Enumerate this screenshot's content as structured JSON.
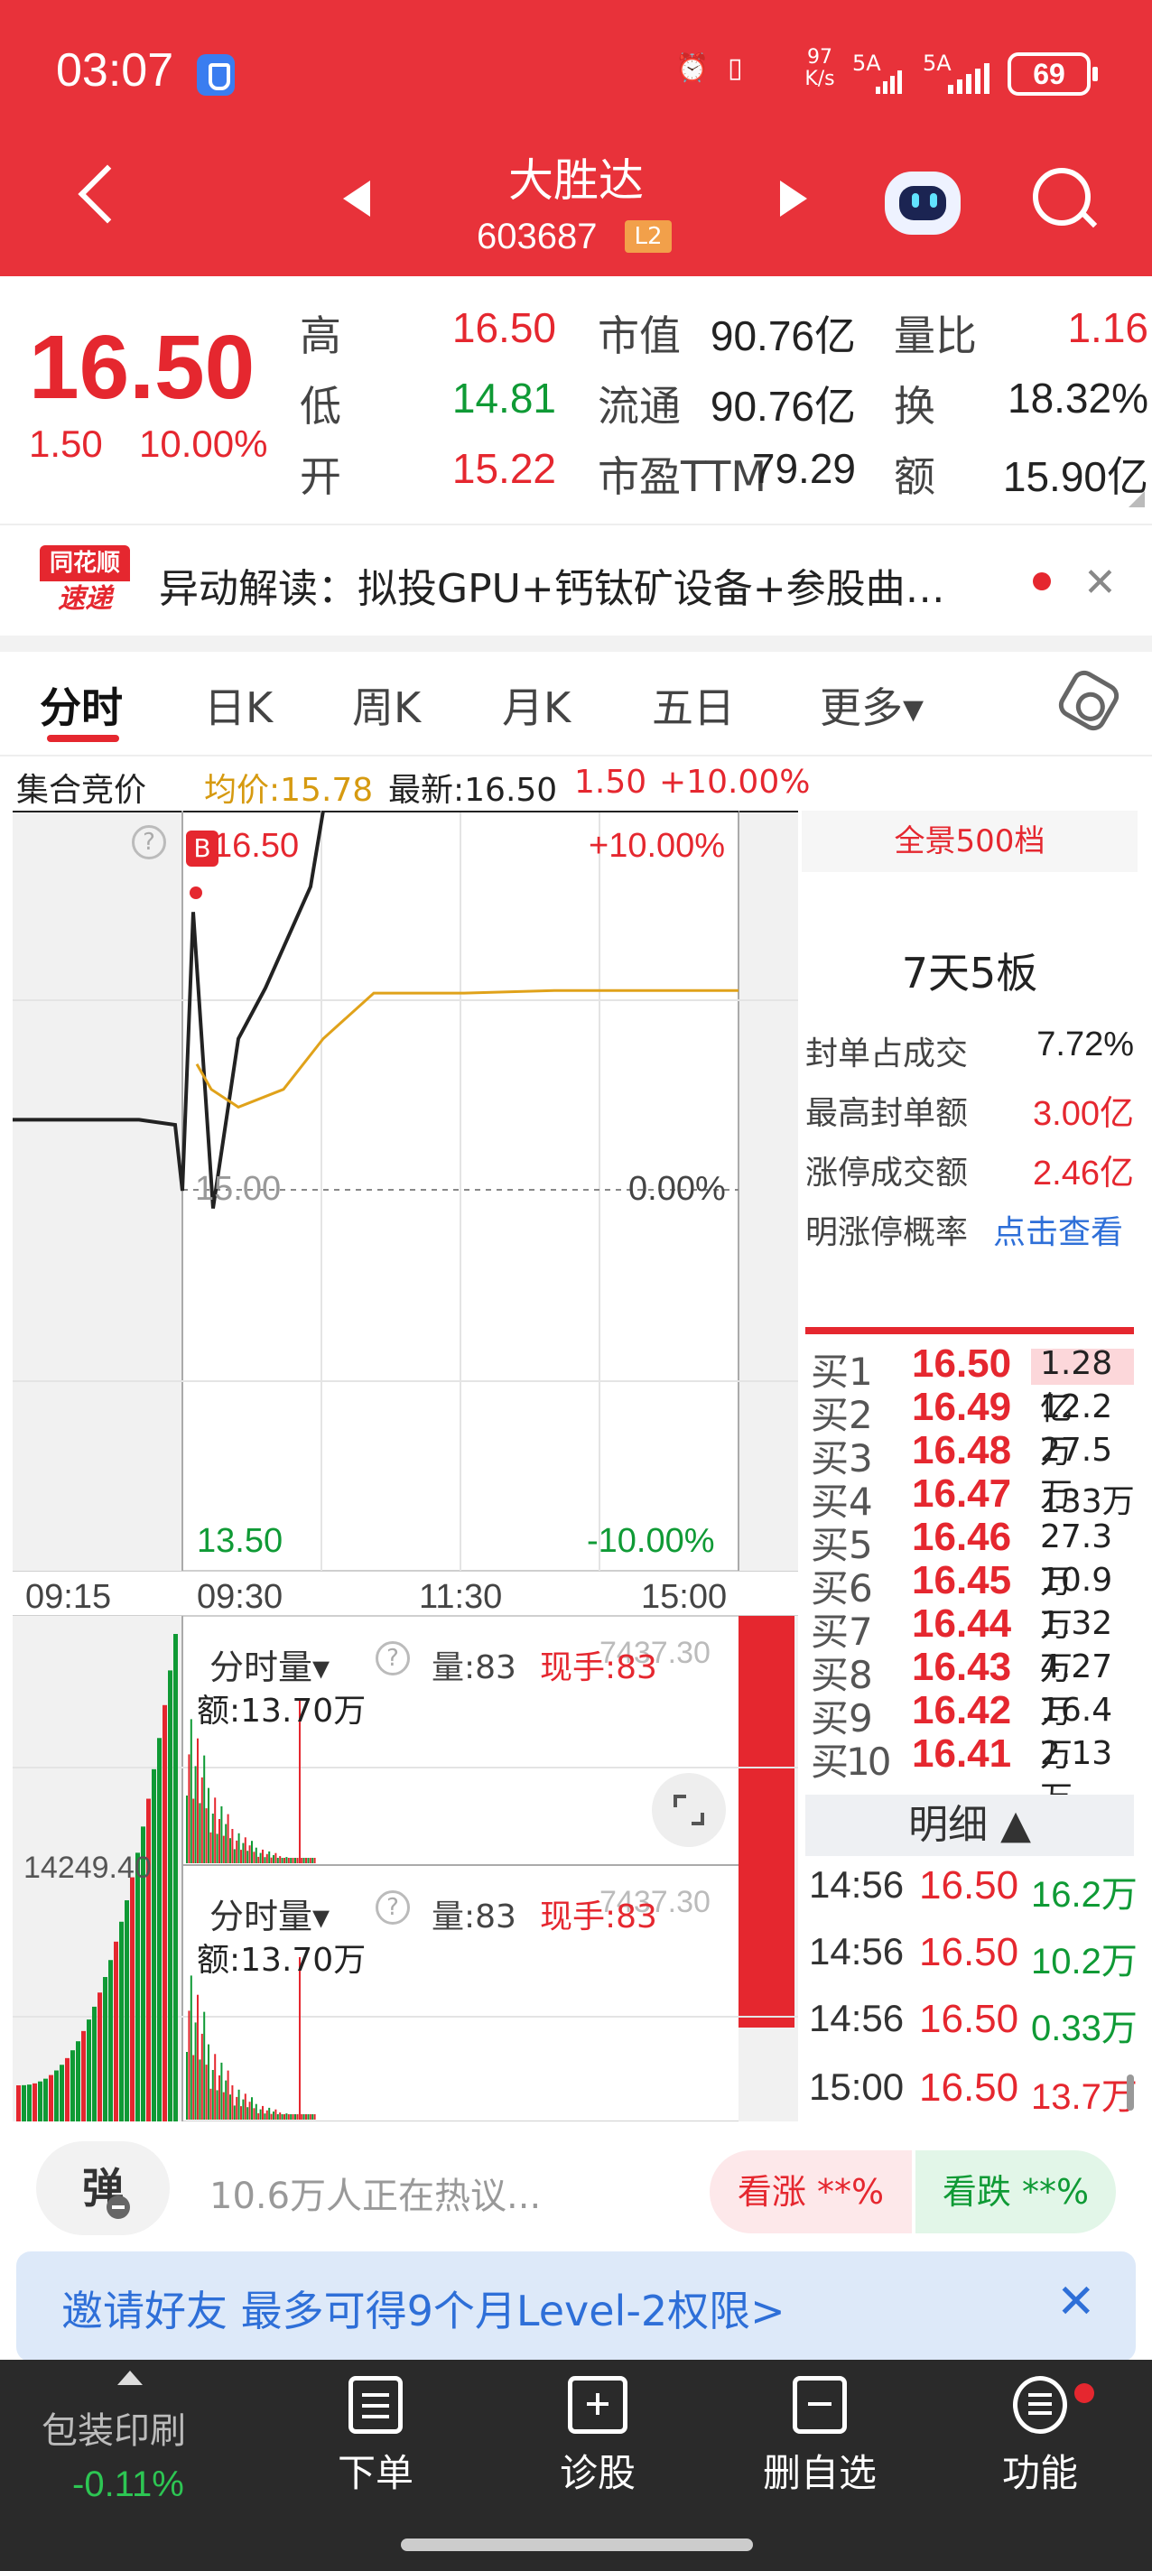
{
  "status_bar": {
    "time": "03:07",
    "net_speed": "97 K/s",
    "signal_1": "5A",
    "signal_2": "5A",
    "battery": "69"
  },
  "header": {
    "stock_name": "大胜达",
    "stock_code": "603687",
    "level_badge": "L2"
  },
  "quote": {
    "price": "16.50",
    "change": "1.50",
    "change_pct": "10.00%",
    "rows": [
      {
        "l1": "高",
        "v1": "16.50",
        "l2": "市值",
        "v2": "90.76亿",
        "l3": "量比",
        "v3": "1.16"
      },
      {
        "l1": "低",
        "v1": "14.81",
        "l2": "流通",
        "v2": "90.76亿",
        "l3": "换",
        "v3": "18.32%"
      },
      {
        "l1": "开",
        "v1": "15.22",
        "l2": "市盈TTM",
        "v2": "79.29",
        "l3": "额",
        "v3": "15.90亿"
      }
    ]
  },
  "news": {
    "logo_top": "同花顺",
    "logo_bottom": "速递",
    "text": "异动解读：拟投GPU+钙钛矿设备+参股曲…",
    "close": "✕"
  },
  "tabs": [
    "分时",
    "日K",
    "周K",
    "月K",
    "五日",
    "更多▾"
  ],
  "info_line": {
    "auction": "集合竞价",
    "avg": "均价:15.78",
    "latest": "最新:16.50",
    "change": "1.50",
    "change_pct": "+10.00%"
  },
  "chart": {
    "top_price": "16.50",
    "top_pct": "+10.00%",
    "mid_price": "15.00",
    "mid_pct": "0.00%",
    "low_price": "13.50",
    "low_pct": "-10.00%",
    "times": [
      "09:15",
      "09:30",
      "11:30",
      "15:00"
    ],
    "b_marker": "B",
    "help": "?",
    "vol_left_value": "14249.40",
    "panels": [
      {
        "title": "分时量▾",
        "vol": "量:83",
        "now": "现手:83",
        "max": "7437.30",
        "amount": "额:13.70万"
      },
      {
        "title": "分时量▾",
        "vol": "量:83",
        "now": "现手:83",
        "max": "7437.30",
        "amount": "额:13.70万"
      }
    ]
  },
  "chart_data": {
    "type": "line",
    "x_labels": [
      "09:15",
      "09:30",
      "11:30",
      "15:00"
    ],
    "ylim": [
      13.5,
      16.5
    ],
    "series": [
      {
        "name": "最新",
        "values": [
          15.28,
          15.28,
          15.28,
          15.26,
          15.0,
          16.1,
          14.93,
          15.6,
          15.8,
          16.2,
          16.5,
          16.5,
          16.5,
          16.5
        ]
      },
      {
        "name": "均价",
        "values": [
          15.5,
          15.4,
          15.33,
          15.4,
          15.6,
          15.78,
          15.78,
          15.79,
          15.79,
          15.79
        ]
      }
    ]
  },
  "orderbook": {
    "header": "全景500档",
    "streak": "7天5板",
    "stats": [
      {
        "label": "封单占成交",
        "value": "7.72%"
      },
      {
        "label": "最高封单额",
        "value": "3.00亿"
      },
      {
        "label": "涨停成交额",
        "value": "2.46亿"
      },
      {
        "label": "明涨停概率",
        "value": "点击查看"
      }
    ],
    "bids": [
      {
        "label": "买1",
        "price": "16.50",
        "vol": "1.28亿"
      },
      {
        "label": "买2",
        "price": "16.49",
        "vol": "12.2万"
      },
      {
        "label": "买3",
        "price": "16.48",
        "vol": "27.5万"
      },
      {
        "label": "买4",
        "price": "16.47",
        "vol": "133万"
      },
      {
        "label": "买5",
        "price": "16.46",
        "vol": "27.3万"
      },
      {
        "label": "买6",
        "price": "16.45",
        "vol": "10.9万"
      },
      {
        "label": "买7",
        "price": "16.44",
        "vol": "1.32万"
      },
      {
        "label": "买8",
        "price": "16.43",
        "vol": "4.27万"
      },
      {
        "label": "买9",
        "price": "16.42",
        "vol": "16.4万"
      },
      {
        "label": "买10",
        "price": "16.41",
        "vol": "2.13万"
      }
    ],
    "detail_header": "明细 ▲",
    "ticks": [
      {
        "time": "14:56",
        "price": "16.50",
        "vol": "16.2万"
      },
      {
        "time": "14:56",
        "price": "16.50",
        "vol": "10.2万"
      },
      {
        "time": "14:56",
        "price": "16.50",
        "vol": "0.33万"
      },
      {
        "time": "15:00",
        "price": "16.50",
        "vol": "13.7万"
      }
    ]
  },
  "social": {
    "danmu": "弹",
    "hot": "10.6万人正在热议...",
    "bull": "看涨 **%",
    "bear": "看跌 **%"
  },
  "invite": {
    "text": "邀请好友 最多可得9个月Level-2权限>",
    "close": "✕"
  },
  "bottom_nav": {
    "sector_name": "包装印刷",
    "sector_change": "-0.11%",
    "items": [
      "下单",
      "诊股",
      "删自选",
      "功能"
    ]
  },
  "colors": {
    "brand_red": "#e8323a",
    "up_red": "#e5272f",
    "down_green": "#0f9a35",
    "avg_line": "#e0a21a"
  }
}
